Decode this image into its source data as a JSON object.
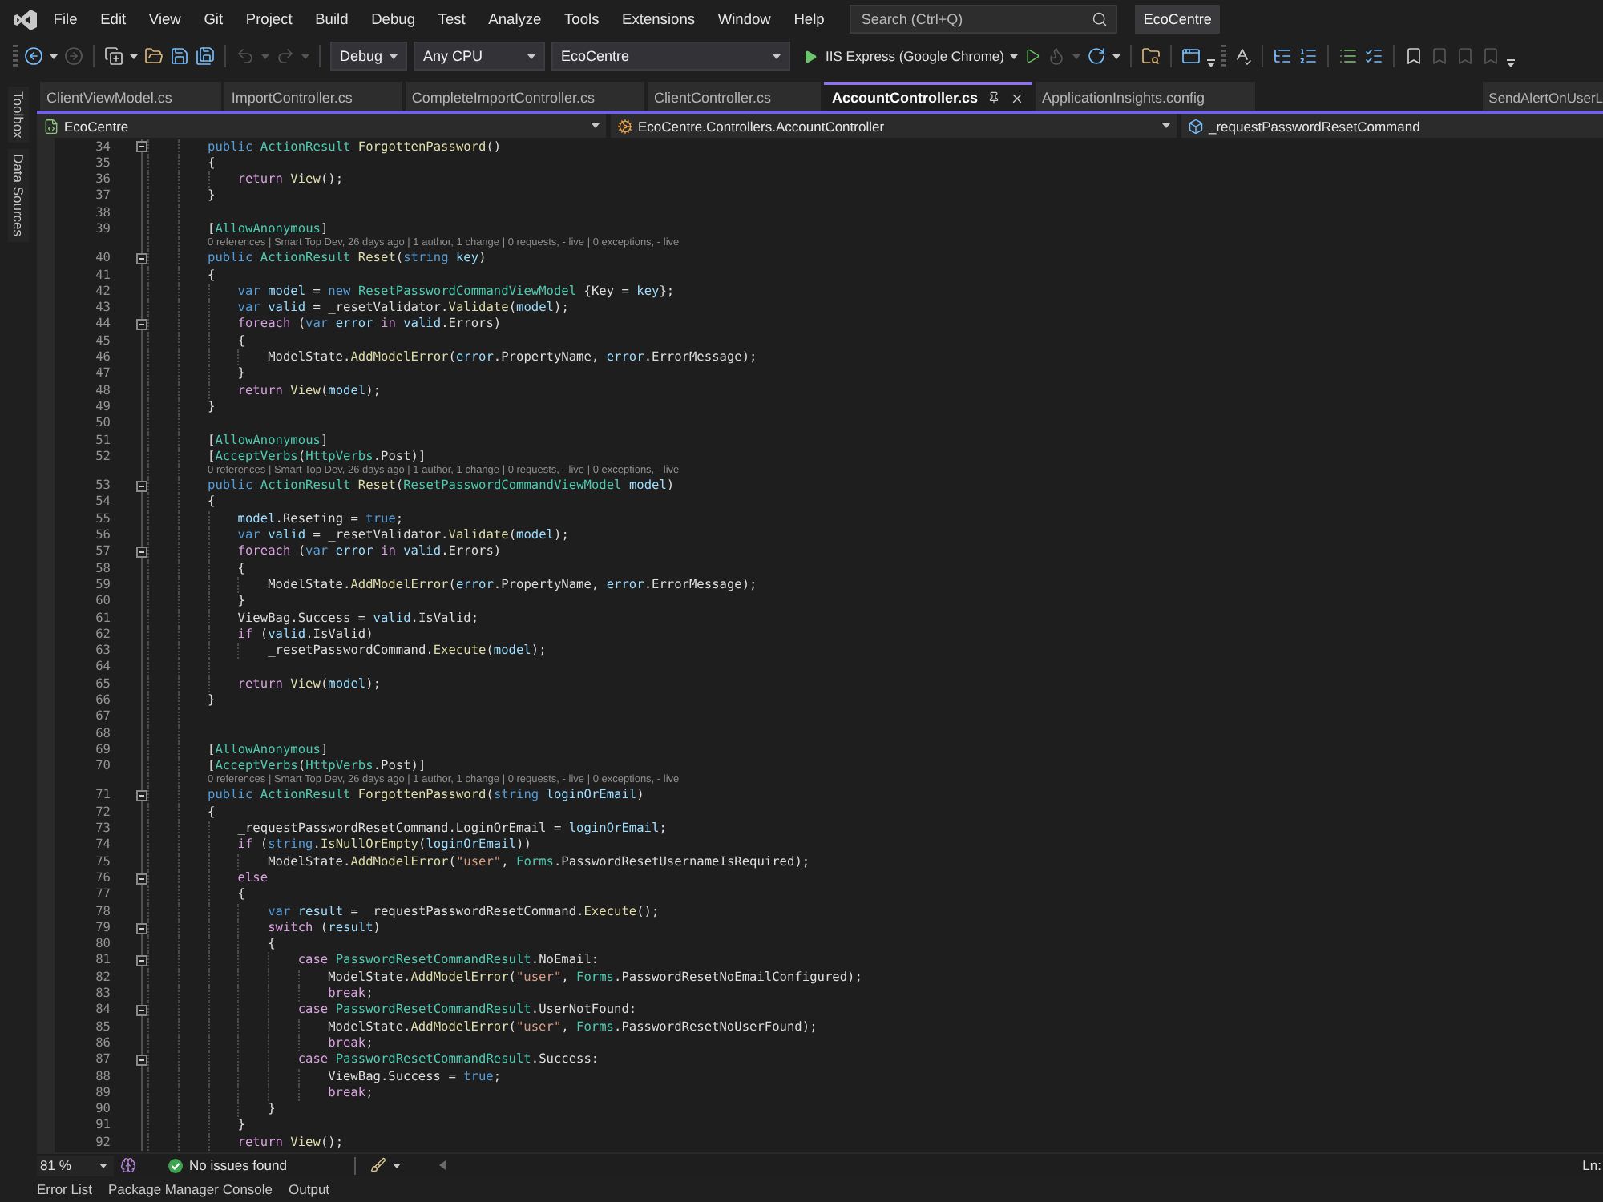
{
  "menu_bar": {
    "menus": [
      "File",
      "Edit",
      "View",
      "Git",
      "Project",
      "Build",
      "Debug",
      "Test",
      "Analyze",
      "Tools",
      "Extensions",
      "Window",
      "Help"
    ],
    "search": {
      "placeholder": "Search (Ctrl+Q)"
    },
    "solution_name": "EcoCentre"
  },
  "toolbar": {
    "configuration": "Debug",
    "platform": "Any CPU",
    "startup_project": "EcoCentre",
    "run_target": "IIS Express (Google Chrome)"
  },
  "side_panels": [
    "Toolbox",
    "Data Sources"
  ],
  "tabs": [
    {
      "label": "ClientViewModel.cs",
      "kind": "document",
      "selected": false
    },
    {
      "label": "ImportController.cs",
      "kind": "document",
      "selected": false
    },
    {
      "label": "CompleteImportController.cs",
      "kind": "document",
      "selected": false
    },
    {
      "label": "ClientController.cs",
      "kind": "document",
      "selected": false
    },
    {
      "label": "AccountController.cs",
      "kind": "document",
      "selected": true
    },
    {
      "label": "ApplicationInsights.config",
      "kind": "document",
      "selected": false
    },
    {
      "label": "SendAlertOnUserL",
      "kind": "preview",
      "selected": false
    }
  ],
  "navigation_bar": {
    "project": "EcoCentre",
    "type": "EcoCentre.Controllers.AccountController",
    "member": "_requestPasswordResetCommand"
  },
  "editor": {
    "lines": [
      {
        "number": "34",
        "expanded": true,
        "tokens": [
          {
            "text": "public ",
            "kind": "keyword"
          },
          {
            "text": "ActionResult ",
            "kind": "type"
          },
          {
            "text": "ForgottenPassword",
            "kind": "method"
          },
          {
            "text": "()",
            "kind": "plain"
          }
        ]
      },
      {
        "number": "35",
        "tokens": [
          {
            "text": "{",
            "kind": "plain"
          }
        ],
        "children": [
          {
            "number": "36",
            "tokens": [
              {
                "text": "return ",
                "kind": "control"
              },
              {
                "text": "View",
                "kind": "method"
              },
              {
                "text": "();",
                "kind": "plain"
              }
            ]
          }
        ]
      },
      {
        "number": "37",
        "tokens": [
          {
            "text": "}",
            "kind": "plain"
          }
        ]
      },
      {
        "number": "38"
      },
      {
        "number": "39",
        "tokens": [
          {
            "text": "[",
            "kind": "plain"
          },
          {
            "text": "AllowAnonymous",
            "kind": "type"
          },
          {
            "text": "]",
            "kind": "plain"
          }
        ]
      },
      {
        "number": "40",
        "codelens": "0 references | Smart Top Dev, 26 days ago | 1 author, 1 change | 0 requests, - live | 0 exceptions, - live",
        "expanded": true,
        "tokens": [
          {
            "text": "public ",
            "kind": "keyword"
          },
          {
            "text": "ActionResult ",
            "kind": "type"
          },
          {
            "text": "Reset",
            "kind": "method"
          },
          {
            "text": "(",
            "kind": "plain"
          },
          {
            "text": "string ",
            "kind": "keyword"
          },
          {
            "text": "key",
            "kind": "variable"
          },
          {
            "text": ")",
            "kind": "plain"
          }
        ]
      },
      {
        "number": "41",
        "tokens": [
          {
            "text": "{",
            "kind": "plain"
          }
        ],
        "children": [
          {
            "number": "42",
            "tokens": [
              {
                "text": "var ",
                "kind": "keyword"
              },
              {
                "text": "model",
                "kind": "variable"
              },
              {
                "text": " = ",
                "kind": "plain"
              },
              {
                "text": "new ",
                "kind": "keyword"
              },
              {
                "text": "ResetPasswordCommandViewModel",
                "kind": "type"
              },
              {
                "text": " {Key = ",
                "kind": "plain"
              },
              {
                "text": "key",
                "kind": "variable"
              },
              {
                "text": "};",
                "kind": "plain"
              }
            ]
          },
          {
            "number": "43",
            "tokens": [
              {
                "text": "var ",
                "kind": "keyword"
              },
              {
                "text": "valid",
                "kind": "variable"
              },
              {
                "text": " = _resetValidator.",
                "kind": "plain"
              },
              {
                "text": "Validate",
                "kind": "method"
              },
              {
                "text": "(",
                "kind": "plain"
              },
              {
                "text": "model",
                "kind": "variable"
              },
              {
                "text": ");",
                "kind": "plain"
              }
            ]
          },
          {
            "number": "44",
            "expanded": true,
            "tokens": [
              {
                "text": "foreach",
                "kind": "control"
              },
              {
                "text": " (",
                "kind": "plain"
              },
              {
                "text": "var ",
                "kind": "keyword"
              },
              {
                "text": "error ",
                "kind": "variable"
              },
              {
                "text": "in ",
                "kind": "control"
              },
              {
                "text": "valid",
                "kind": "variable"
              },
              {
                "text": ".Errors)",
                "kind": "plain"
              }
            ]
          },
          {
            "number": "45",
            "tokens": [
              {
                "text": "{",
                "kind": "plain"
              }
            ],
            "children": [
              {
                "number": "46",
                "tokens": [
                  {
                    "text": "ModelState.",
                    "kind": "plain"
                  },
                  {
                    "text": "AddModelError",
                    "kind": "method"
                  },
                  {
                    "text": "(",
                    "kind": "plain"
                  },
                  {
                    "text": "error",
                    "kind": "variable"
                  },
                  {
                    "text": ".PropertyName, ",
                    "kind": "plain"
                  },
                  {
                    "text": "error",
                    "kind": "variable"
                  },
                  {
                    "text": ".ErrorMessage);",
                    "kind": "plain"
                  }
                ]
              }
            ]
          },
          {
            "number": "47",
            "tokens": [
              {
                "text": "}",
                "kind": "plain"
              }
            ]
          },
          {
            "number": "48",
            "tokens": [
              {
                "text": "return ",
                "kind": "control"
              },
              {
                "text": "View",
                "kind": "method"
              },
              {
                "text": "(",
                "kind": "plain"
              },
              {
                "text": "model",
                "kind": "variable"
              },
              {
                "text": ");",
                "kind": "plain"
              }
            ]
          }
        ]
      },
      {
        "number": "49",
        "tokens": [
          {
            "text": "}",
            "kind": "plain"
          }
        ]
      },
      {
        "number": "50"
      },
      {
        "number": "51",
        "tokens": [
          {
            "text": "[",
            "kind": "plain"
          },
          {
            "text": "AllowAnonymous",
            "kind": "type"
          },
          {
            "text": "]",
            "kind": "plain"
          }
        ]
      },
      {
        "number": "52",
        "tokens": [
          {
            "text": "[",
            "kind": "plain"
          },
          {
            "text": "AcceptVerbs",
            "kind": "type"
          },
          {
            "text": "(",
            "kind": "plain"
          },
          {
            "text": "HttpVerbs",
            "kind": "type"
          },
          {
            "text": ".Post)]",
            "kind": "plain"
          }
        ]
      },
      {
        "number": "53",
        "codelens": "0 references | Smart Top Dev, 26 days ago | 1 author, 1 change | 0 requests, - live | 0 exceptions, - live",
        "expanded": true,
        "tokens": [
          {
            "text": "public ",
            "kind": "keyword"
          },
          {
            "text": "ActionResult ",
            "kind": "type"
          },
          {
            "text": "Reset",
            "kind": "method"
          },
          {
            "text": "(",
            "kind": "plain"
          },
          {
            "text": "ResetPasswordCommandViewModel ",
            "kind": "type"
          },
          {
            "text": "model",
            "kind": "variable"
          },
          {
            "text": ")",
            "kind": "plain"
          }
        ]
      },
      {
        "number": "54",
        "tokens": [
          {
            "text": "{",
            "kind": "plain"
          }
        ],
        "children": [
          {
            "number": "55",
            "tokens": [
              {
                "text": "model",
                "kind": "variable"
              },
              {
                "text": ".Reseting = ",
                "kind": "plain"
              },
              {
                "text": "true",
                "kind": "keyword"
              },
              {
                "text": ";",
                "kind": "plain"
              }
            ]
          },
          {
            "number": "56",
            "tokens": [
              {
                "text": "var ",
                "kind": "keyword"
              },
              {
                "text": "valid",
                "kind": "variable"
              },
              {
                "text": " = _resetValidator.",
                "kind": "plain"
              },
              {
                "text": "Validate",
                "kind": "method"
              },
              {
                "text": "(",
                "kind": "plain"
              },
              {
                "text": "model",
                "kind": "variable"
              },
              {
                "text": ");",
                "kind": "plain"
              }
            ]
          },
          {
            "number": "57",
            "expanded": true,
            "tokens": [
              {
                "text": "foreach",
                "kind": "control"
              },
              {
                "text": " (",
                "kind": "plain"
              },
              {
                "text": "var ",
                "kind": "keyword"
              },
              {
                "text": "error ",
                "kind": "variable"
              },
              {
                "text": "in ",
                "kind": "control"
              },
              {
                "text": "valid",
                "kind": "variable"
              },
              {
                "text": ".Errors)",
                "kind": "plain"
              }
            ]
          },
          {
            "number": "58",
            "tokens": [
              {
                "text": "{",
                "kind": "plain"
              }
            ],
            "children": [
              {
                "number": "59",
                "tokens": [
                  {
                    "text": "ModelState.",
                    "kind": "plain"
                  },
                  {
                    "text": "AddModelError",
                    "kind": "method"
                  },
                  {
                    "text": "(",
                    "kind": "plain"
                  },
                  {
                    "text": "error",
                    "kind": "variable"
                  },
                  {
                    "text": ".PropertyName, ",
                    "kind": "plain"
                  },
                  {
                    "text": "error",
                    "kind": "variable"
                  },
                  {
                    "text": ".ErrorMessage);",
                    "kind": "plain"
                  }
                ]
              }
            ]
          },
          {
            "number": "60",
            "tokens": [
              {
                "text": "}",
                "kind": "plain"
              }
            ]
          },
          {
            "number": "61",
            "tokens": [
              {
                "text": "ViewBag.Success = ",
                "kind": "plain"
              },
              {
                "text": "valid",
                "kind": "variable"
              },
              {
                "text": ".IsValid;",
                "kind": "plain"
              }
            ]
          },
          {
            "number": "62",
            "tokens": [
              {
                "text": "if",
                "kind": "control"
              },
              {
                "text": " (",
                "kind": "plain"
              },
              {
                "text": "valid",
                "kind": "variable"
              },
              {
                "text": ".IsValid)",
                "kind": "plain"
              }
            ],
            "children": [
              {
                "number": "63",
                "tokens": [
                  {
                    "text": "_resetPasswordCommand.",
                    "kind": "plain"
                  },
                  {
                    "text": "Execute",
                    "kind": "method"
                  },
                  {
                    "text": "(",
                    "kind": "plain"
                  },
                  {
                    "text": "model",
                    "kind": "variable"
                  },
                  {
                    "text": ");",
                    "kind": "plain"
                  }
                ]
              }
            ]
          },
          {
            "number": "64"
          },
          {
            "number": "65",
            "tokens": [
              {
                "text": "return ",
                "kind": "control"
              },
              {
                "text": "View",
                "kind": "method"
              },
              {
                "text": "(",
                "kind": "plain"
              },
              {
                "text": "model",
                "kind": "variable"
              },
              {
                "text": ");",
                "kind": "plain"
              }
            ]
          }
        ]
      },
      {
        "number": "66",
        "tokens": [
          {
            "text": "}",
            "kind": "plain"
          }
        ]
      },
      {
        "number": "67"
      },
      {
        "number": "68"
      },
      {
        "number": "69",
        "tokens": [
          {
            "text": "[",
            "kind": "plain"
          },
          {
            "text": "AllowAnonymous",
            "kind": "type"
          },
          {
            "text": "]",
            "kind": "plain"
          }
        ]
      },
      {
        "number": "70",
        "tokens": [
          {
            "text": "[",
            "kind": "plain"
          },
          {
            "text": "AcceptVerbs",
            "kind": "type"
          },
          {
            "text": "(",
            "kind": "plain"
          },
          {
            "text": "HttpVerbs",
            "kind": "type"
          },
          {
            "text": ".Post)]",
            "kind": "plain"
          }
        ]
      },
      {
        "number": "71",
        "codelens": "0 references | Smart Top Dev, 26 days ago | 1 author, 1 change | 0 requests, - live | 0 exceptions, - live",
        "expanded": true,
        "tokens": [
          {
            "text": "public ",
            "kind": "keyword"
          },
          {
            "text": "ActionResult ",
            "kind": "type"
          },
          {
            "text": "ForgottenPassword",
            "kind": "method"
          },
          {
            "text": "(",
            "kind": "plain"
          },
          {
            "text": "string ",
            "kind": "keyword"
          },
          {
            "text": "loginOrEmail",
            "kind": "variable"
          },
          {
            "text": ")",
            "kind": "plain"
          }
        ]
      },
      {
        "number": "72",
        "tokens": [
          {
            "text": "{",
            "kind": "plain"
          }
        ],
        "children": [
          {
            "number": "73",
            "tokens": [
              {
                "text": "_requestPasswordResetCommand.LoginOrEmail = ",
                "kind": "plain"
              },
              {
                "text": "loginOrEmail",
                "kind": "variable"
              },
              {
                "text": ";",
                "kind": "plain"
              }
            ]
          },
          {
            "number": "74",
            "tokens": [
              {
                "text": "if",
                "kind": "control"
              },
              {
                "text": " (",
                "kind": "plain"
              },
              {
                "text": "string",
                "kind": "keyword"
              },
              {
                "text": ".",
                "kind": "plain"
              },
              {
                "text": "IsNullOrEmpty",
                "kind": "method"
              },
              {
                "text": "(",
                "kind": "plain"
              },
              {
                "text": "loginOrEmail",
                "kind": "variable"
              },
              {
                "text": "))",
                "kind": "plain"
              }
            ],
            "children": [
              {
                "number": "75",
                "tokens": [
                  {
                    "text": "ModelState.",
                    "kind": "plain"
                  },
                  {
                    "text": "AddModelError",
                    "kind": "method"
                  },
                  {
                    "text": "(",
                    "kind": "plain"
                  },
                  {
                    "text": "\"user\"",
                    "kind": "string"
                  },
                  {
                    "text": ", ",
                    "kind": "plain"
                  },
                  {
                    "text": "Forms",
                    "kind": "type"
                  },
                  {
                    "text": ".PasswordResetUsernameIsRequired);",
                    "kind": "plain"
                  }
                ]
              }
            ]
          },
          {
            "number": "76",
            "expanded": true,
            "tokens": [
              {
                "text": "else",
                "kind": "control"
              }
            ]
          },
          {
            "number": "77",
            "tokens": [
              {
                "text": "{",
                "kind": "plain"
              }
            ],
            "children": [
              {
                "number": "78",
                "tokens": [
                  {
                    "text": "var ",
                    "kind": "keyword"
                  },
                  {
                    "text": "result",
                    "kind": "variable"
                  },
                  {
                    "text": " = _requestPasswordResetCommand.",
                    "kind": "plain"
                  },
                  {
                    "text": "Execute",
                    "kind": "method"
                  },
                  {
                    "text": "();",
                    "kind": "plain"
                  }
                ]
              },
              {
                "number": "79",
                "expanded": true,
                "tokens": [
                  {
                    "text": "switch",
                    "kind": "control"
                  },
                  {
                    "text": " (",
                    "kind": "plain"
                  },
                  {
                    "text": "result",
                    "kind": "variable"
                  },
                  {
                    "text": ")",
                    "kind": "plain"
                  }
                ]
              },
              {
                "number": "80",
                "tokens": [
                  {
                    "text": "{",
                    "kind": "plain"
                  }
                ],
                "children": [
                  {
                    "number": "81",
                    "expanded": true,
                    "tokens": [
                      {
                        "text": "case ",
                        "kind": "control"
                      },
                      {
                        "text": "PasswordResetCommandResult",
                        "kind": "type"
                      },
                      {
                        "text": ".NoEmail:",
                        "kind": "plain"
                      }
                    ],
                    "children": [
                      {
                        "number": "82",
                        "tokens": [
                          {
                            "text": "ModelState.",
                            "kind": "plain"
                          },
                          {
                            "text": "AddModelError",
                            "kind": "method"
                          },
                          {
                            "text": "(",
                            "kind": "plain"
                          },
                          {
                            "text": "\"user\"",
                            "kind": "string"
                          },
                          {
                            "text": ", ",
                            "kind": "plain"
                          },
                          {
                            "text": "Forms",
                            "kind": "type"
                          },
                          {
                            "text": ".PasswordResetNoEmailConfigured);",
                            "kind": "plain"
                          }
                        ]
                      },
                      {
                        "number": "83",
                        "tokens": [
                          {
                            "text": "break",
                            "kind": "control"
                          },
                          {
                            "text": ";",
                            "kind": "plain"
                          }
                        ]
                      }
                    ]
                  },
                  {
                    "number": "84",
                    "expanded": true,
                    "tokens": [
                      {
                        "text": "case ",
                        "kind": "control"
                      },
                      {
                        "text": "PasswordResetCommandResult",
                        "kind": "type"
                      },
                      {
                        "text": ".UserNotFound:",
                        "kind": "plain"
                      }
                    ],
                    "children": [
                      {
                        "number": "85",
                        "tokens": [
                          {
                            "text": "ModelState.",
                            "kind": "plain"
                          },
                          {
                            "text": "AddModelError",
                            "kind": "method"
                          },
                          {
                            "text": "(",
                            "kind": "plain"
                          },
                          {
                            "text": "\"user\"",
                            "kind": "string"
                          },
                          {
                            "text": ", ",
                            "kind": "plain"
                          },
                          {
                            "text": "Forms",
                            "kind": "type"
                          },
                          {
                            "text": ".PasswordResetNoUserFound);",
                            "kind": "plain"
                          }
                        ]
                      },
                      {
                        "number": "86",
                        "tokens": [
                          {
                            "text": "break",
                            "kind": "control"
                          },
                          {
                            "text": ";",
                            "kind": "plain"
                          }
                        ]
                      }
                    ]
                  },
                  {
                    "number": "87",
                    "expanded": true,
                    "tokens": [
                      {
                        "text": "case ",
                        "kind": "control"
                      },
                      {
                        "text": "PasswordResetCommandResult",
                        "kind": "type"
                      },
                      {
                        "text": ".Success:",
                        "kind": "plain"
                      }
                    ],
                    "children": [
                      {
                        "number": "88",
                        "tokens": [
                          {
                            "text": "ViewBag.Success = ",
                            "kind": "plain"
                          },
                          {
                            "text": "true",
                            "kind": "keyword"
                          },
                          {
                            "text": ";",
                            "kind": "plain"
                          }
                        ]
                      },
                      {
                        "number": "89",
                        "tokens": [
                          {
                            "text": "break",
                            "kind": "control"
                          },
                          {
                            "text": ";",
                            "kind": "plain"
                          }
                        ]
                      }
                    ]
                  }
                ]
              },
              {
                "number": "90",
                "tokens": [
                  {
                    "text": "}",
                    "kind": "plain"
                  }
                ]
              }
            ]
          },
          {
            "number": "91",
            "tokens": [
              {
                "text": "}",
                "kind": "plain"
              }
            ]
          },
          {
            "number": "92",
            "tokens": [
              {
                "text": "return ",
                "kind": "control"
              },
              {
                "text": "View",
                "kind": "method"
              },
              {
                "text": "();",
                "kind": "plain"
              }
            ]
          }
        ]
      }
    ]
  },
  "status_bar": {
    "zoom": "81 %",
    "issues": "No issues found",
    "position": "Ln:"
  },
  "tool_windows": [
    "Error List",
    "Package Manager Console",
    "Output"
  ]
}
